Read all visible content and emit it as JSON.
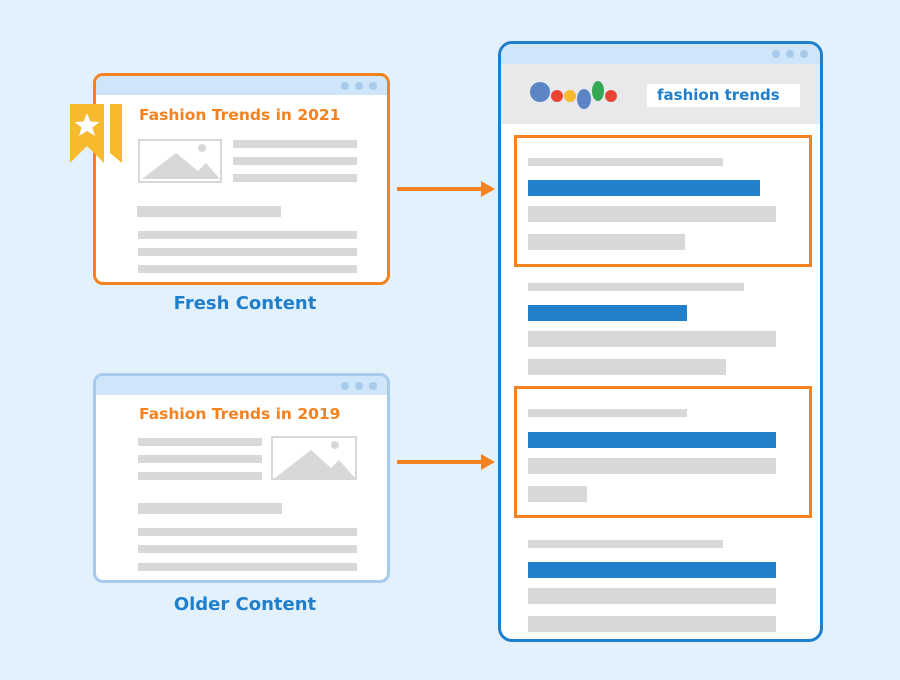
{
  "diagram": {
    "fresh": {
      "window_title": "Fashion Trends in 2021",
      "caption": "Fresh Content",
      "badge_icon": "bookmark-star-icon",
      "border_color": "#f58220"
    },
    "older": {
      "window_title": "Fashion Trends in 2019",
      "caption": "Older Content",
      "border_color": "#a6cbed"
    },
    "arrows": [
      {
        "from": "fresh",
        "to": "search-result-1",
        "color": "#f58220"
      },
      {
        "from": "older",
        "to": "search-result-3",
        "color": "#f58220"
      }
    ],
    "search": {
      "logo_icon": "google-dots-logo-icon",
      "query": "fashion trends",
      "results": [
        {
          "highlighted": true
        },
        {
          "highlighted": false
        },
        {
          "highlighted": true
        },
        {
          "highlighted": false
        }
      ]
    },
    "colors": {
      "background": "#e3f1fc",
      "accent_orange": "#f58220",
      "accent_blue": "#1f7fcc",
      "placeholder_gray": "#d7d8d9"
    }
  }
}
